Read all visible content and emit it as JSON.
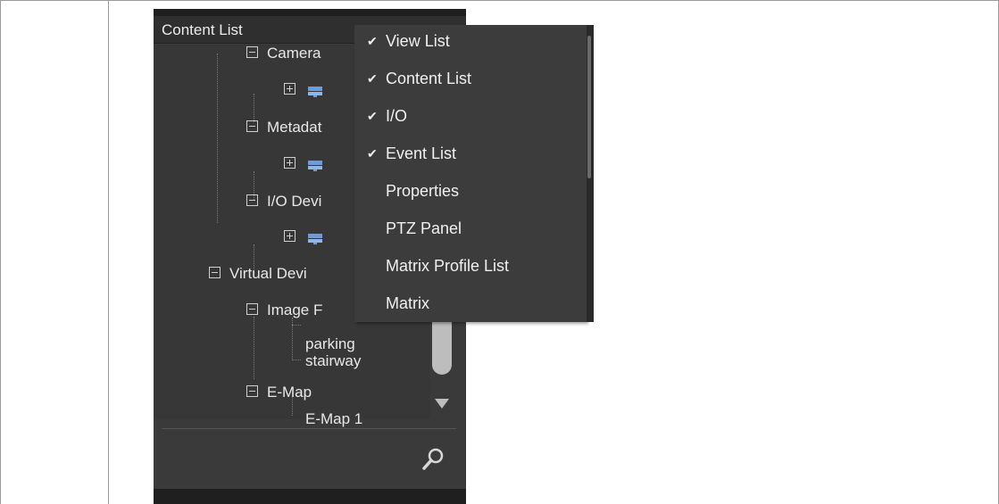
{
  "panel": {
    "title": "Content List",
    "tree": [
      {
        "label": "Camera",
        "indent": 1,
        "expander": "minus"
      },
      {
        "label": "",
        "indent": 2,
        "expander": "plus",
        "icon": "device-icon"
      },
      {
        "label": "Metadat",
        "indent": 1,
        "expander": "minus"
      },
      {
        "label": "",
        "indent": 2,
        "expander": "plus",
        "icon": "device-icon"
      },
      {
        "label": "I/O Devi",
        "indent": 1,
        "expander": "minus"
      },
      {
        "label": "",
        "indent": 2,
        "expander": "plus",
        "icon": "device-icon"
      },
      {
        "label": "Virtual Devi",
        "indent": 0,
        "expander": "minus"
      },
      {
        "label": "Image F",
        "indent": 1,
        "expander": "minus"
      },
      {
        "label": "parking",
        "indent": 2,
        "leaf": true
      },
      {
        "label": "stairway",
        "indent": 2,
        "leaf": true
      },
      {
        "label": "E-Map",
        "indent": 1,
        "expander": "minus"
      },
      {
        "label": "E-Map 1",
        "indent": 2,
        "leaf": true
      }
    ],
    "search_icon": "search-icon"
  },
  "context_menu": {
    "items": [
      {
        "label": "View List",
        "checked": true
      },
      {
        "label": "Content List",
        "checked": true
      },
      {
        "label": "I/O",
        "checked": true
      },
      {
        "label": "Event List",
        "checked": true
      },
      {
        "label": "Properties",
        "checked": false
      },
      {
        "label": "PTZ Panel",
        "checked": false
      },
      {
        "label": "Matrix Profile List",
        "checked": false
      },
      {
        "label": "Matrix",
        "checked": false
      }
    ],
    "check_glyph": "✔"
  },
  "colors": {
    "panel_bg": "#3a3a3a",
    "menu_bg": "#3c3c3c",
    "text": "#e8e8e8",
    "scroll_thumb": "#bdbdbd"
  }
}
